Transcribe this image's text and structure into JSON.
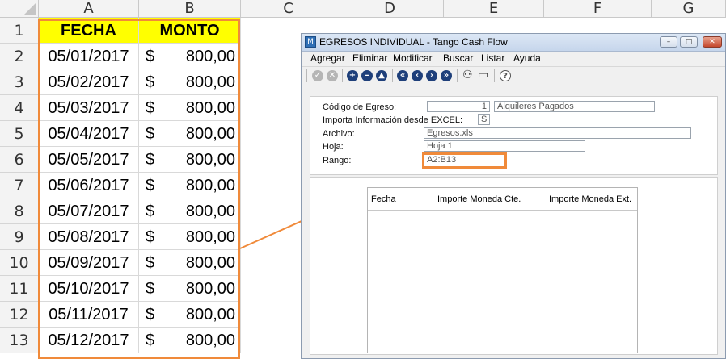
{
  "sheet": {
    "columns": [
      "A",
      "B",
      "C",
      "D",
      "E",
      "F",
      "G"
    ],
    "rows": [
      "1",
      "2",
      "3",
      "4",
      "5",
      "6",
      "7",
      "8",
      "9",
      "10",
      "11",
      "12",
      "13"
    ],
    "header": {
      "fecha": "FECHA",
      "monto": "MONTO"
    },
    "data": [
      {
        "fecha": "05/01/2017",
        "currency": "$",
        "amount": "800,00"
      },
      {
        "fecha": "05/02/2017",
        "currency": "$",
        "amount": "800,00"
      },
      {
        "fecha": "05/03/2017",
        "currency": "$",
        "amount": "800,00"
      },
      {
        "fecha": "05/04/2017",
        "currency": "$",
        "amount": "800,00"
      },
      {
        "fecha": "05/05/2017",
        "currency": "$",
        "amount": "800,00"
      },
      {
        "fecha": "05/06/2017",
        "currency": "$",
        "amount": "800,00"
      },
      {
        "fecha": "05/07/2017",
        "currency": "$",
        "amount": "800,00"
      },
      {
        "fecha": "05/08/2017",
        "currency": "$",
        "amount": "800,00"
      },
      {
        "fecha": "05/09/2017",
        "currency": "$",
        "amount": "800,00"
      },
      {
        "fecha": "05/10/2017",
        "currency": "$",
        "amount": "800,00"
      },
      {
        "fecha": "05/11/2017",
        "currency": "$",
        "amount": "800,00"
      },
      {
        "fecha": "05/12/2017",
        "currency": "$",
        "amount": "800,00"
      }
    ],
    "header_fill": "#ffff00",
    "highlight_color": "#f08a3a"
  },
  "window": {
    "title": "EGRESOS INDIVIDUAL - Tango Cash Flow",
    "controls": [
      "minimize-icon",
      "maximize-icon",
      "close-icon"
    ],
    "menu": [
      "Agregar",
      "Eliminar",
      "Modificar",
      "Buscar",
      "Listar",
      "Ayuda"
    ],
    "toolbar_icons": [
      "confirm-icon",
      "cancel-icon",
      "add-icon",
      "remove-icon",
      "up-icon",
      "first-icon",
      "previous-icon",
      "next-icon",
      "last-icon",
      "find-icon",
      "screen-icon",
      "help-icon"
    ],
    "form": {
      "codigo_label": "Código de Egreso:",
      "codigo_num": "1",
      "codigo_desc": "Alquileres Pagados",
      "importa_label": "Importa Información desde EXCEL:",
      "importa_value": "S",
      "archivo_label": "Archivo:",
      "archivo_value": "Egresos.xls",
      "hoja_label": "Hoja:",
      "hoja_value": "Hoja 1",
      "rango_label": "Rango:",
      "rango_value": "A2:B13"
    },
    "grid_headers": [
      "Fecha",
      "Importe Moneda Cte.",
      "Importe Moneda Ext."
    ]
  }
}
